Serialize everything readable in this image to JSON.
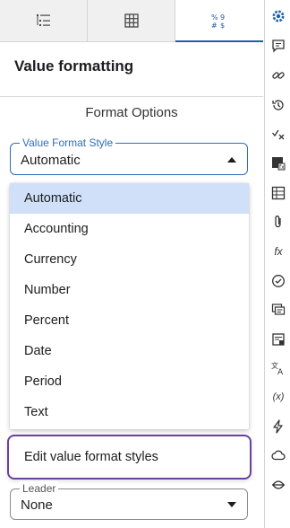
{
  "tabs": [
    {
      "icon": "list-indent-icon",
      "active": false
    },
    {
      "icon": "table-grid-icon",
      "active": false
    },
    {
      "icon": "number-format-icon",
      "label": "% ⁹\n# $",
      "active": true
    }
  ],
  "panel": {
    "title": "Value formatting",
    "section_heading": "Format Options"
  },
  "format_style": {
    "legend": "Value Format Style",
    "value": "Automatic",
    "options": [
      "Automatic",
      "Accounting",
      "Currency",
      "Number",
      "Percent",
      "Date",
      "Period",
      "Text"
    ],
    "selected": "Automatic",
    "edit_label": "Edit value format styles"
  },
  "leader": {
    "legend": "Leader",
    "value": "None"
  },
  "rail": {
    "items": [
      "gear-icon",
      "comment-icon",
      "link-icon",
      "history-icon",
      "check-x-icon",
      "table-function-icon",
      "grid-icon",
      "attachment-icon",
      "function-icon",
      "check-circle-icon",
      "messages-icon",
      "note-icon",
      "translate-icon",
      "variable-icon",
      "lightning-icon",
      "cloud-icon",
      "eye-strike-icon"
    ],
    "function_text": "fx",
    "variable_text": "(x)"
  },
  "colors": {
    "accent": "#1f5fa8",
    "selected_bg": "#cfe0f8",
    "focus_purple": "#6c3fa3"
  }
}
